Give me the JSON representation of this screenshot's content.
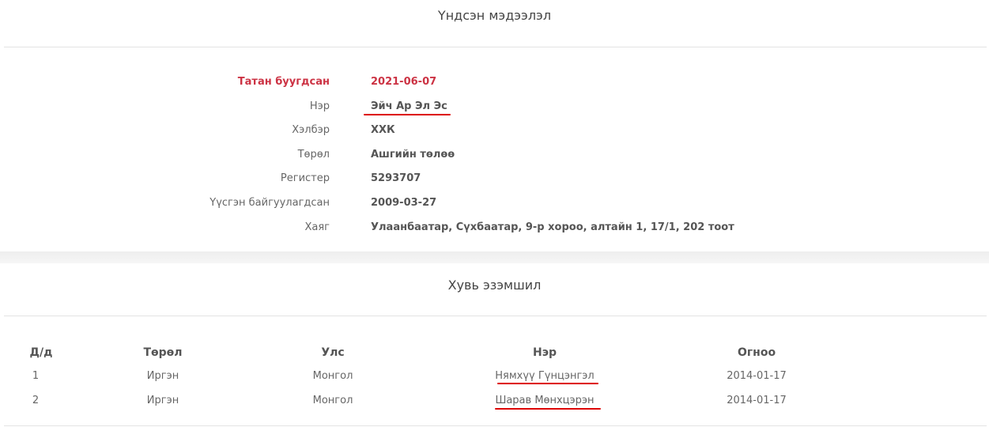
{
  "basic_info": {
    "title": "Үндсэн мэдээлэл",
    "rows": [
      {
        "label": "Татан буугдсан",
        "value": "2021-06-07"
      },
      {
        "label": "Нэр",
        "value": "Эйч Ар Эл Эс"
      },
      {
        "label": "Хэлбэр",
        "value": "ХХК"
      },
      {
        "label": "Төрөл",
        "value": "Ашгийн төлөө"
      },
      {
        "label": "Регистер",
        "value": "5293707"
      },
      {
        "label": "Үүсгэн байгуулагдсан",
        "value": "2009-03-27"
      },
      {
        "label": "Хаяг",
        "value": "Улаанбаатар, Сүхбаатар, 9-р хороо, алтайн 1, 17/1, 202 тоот"
      }
    ]
  },
  "ownership": {
    "title": "Хувь эзэмшил",
    "columns": [
      "Д/д",
      "Төрөл",
      "Улс",
      "Нэр",
      "Огноо"
    ],
    "rows": [
      [
        "1",
        "Иргэн",
        "Монгол",
        "Нямхүү Гүнцэнгэл",
        "2014-01-17"
      ],
      [
        "2",
        "Иргэн",
        "Монгол",
        "Шарав Мөнхцэрэн",
        "2014-01-17"
      ]
    ]
  },
  "colors": {
    "accent": "#cc3344",
    "annotation_underline": "#dd0000"
  }
}
